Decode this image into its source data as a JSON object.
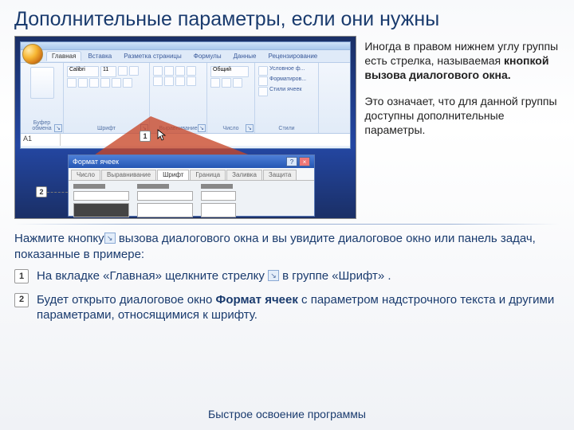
{
  "slide": {
    "title": "Дополнительные параметры, если они нужны",
    "footer": "Быстрое освоение программы"
  },
  "ribbon": {
    "tabs": [
      "Главная",
      "Вставка",
      "Разметка страницы",
      "Формулы",
      "Данные",
      "Рецензирование"
    ],
    "active_tab_index": 0,
    "groups": {
      "clipboard": "Буфер обмена",
      "font": "Шрифт",
      "alignment": "Выравнивание",
      "number": "Число",
      "styles": "Стили"
    },
    "font_name": "Calibri",
    "font_size": "11",
    "number_format": "Общий",
    "styles_items": [
      "Условное ф...",
      "Форматиров...",
      "Стили ячеек"
    ],
    "name_box": "A1"
  },
  "markers": {
    "m1": "1",
    "m2": "2"
  },
  "dialog": {
    "title": "Формат ячеек",
    "tabs": [
      "Число",
      "Выравнивание",
      "Шрифт",
      "Граница",
      "Заливка",
      "Защита"
    ],
    "active_tab_index": 2,
    "help_icon": "?",
    "close_icon": "×"
  },
  "right": {
    "p1_a": "Иногда в правом нижнем углу группы есть стрелка, называемая ",
    "p1_b": "кнопкой вызова диалогового окна.",
    "p2": "Это означает, что для данной группы доступны дополнительные параметры."
  },
  "intro": {
    "a": "Нажмите кнопку",
    "b": " вызова диалогового окна и вы увидите диалоговое окно или панель задач, показанные в примере:"
  },
  "steps": {
    "s1_a": "На вкладке «Главная» щелкните стрелку ",
    "s1_b": " в группе «Шрифт» .",
    "s2_a": "Будет открыто диалоговое окно ",
    "s2_b": "Формат ячеек",
    "s2_c": " с параметром надстрочного текста и другими параметрами, относящимися к шрифту."
  }
}
